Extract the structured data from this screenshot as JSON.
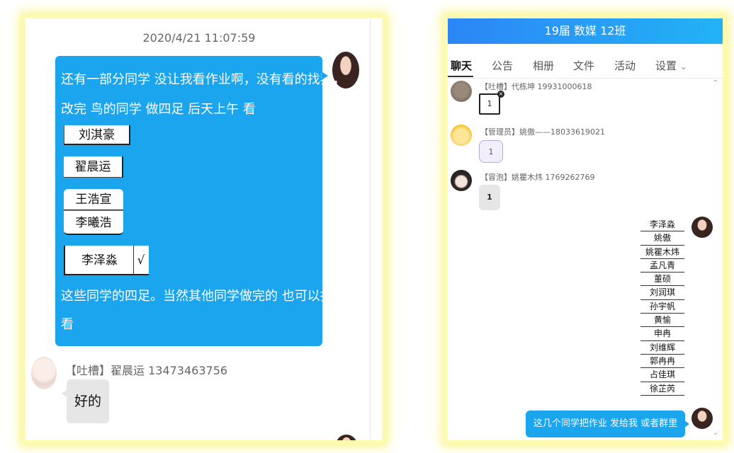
{
  "left": {
    "timestamp": "2020/4/21 11:07:59",
    "message_line1": "还有一部分同学 没让我看作业啊，没有看的找我，",
    "message_line2": "改完 鸟的同学 做四足 后天上午 看",
    "names": [
      "刘淇豪",
      "翟晨运",
      "王浩宣",
      "李曦浩",
      "李泽淼"
    ],
    "check_mark": "√",
    "message_line3": "这些同学的四足。当然其他同学做完的 也可以找我",
    "message_line4": "看",
    "reply_sender": "【吐槽】翟晨运 13473463756",
    "reply_text": "好的"
  },
  "right": {
    "header_title": "19届 数媒 12班",
    "tabs": [
      "聊天",
      "公告",
      "相册",
      "文件",
      "活动",
      "设置"
    ],
    "settings_caret": "⌄",
    "messages": [
      {
        "sender": "【吐槽】代栋坤  19931000618",
        "text": "1"
      },
      {
        "sender": "【管理员】姚傲——18033619021",
        "text": "1"
      },
      {
        "sender": "【冒泡】姚瞿木炜 1769262769",
        "text": "1"
      }
    ],
    "name_list": [
      "李泽淼",
      "姚傲",
      "姚瞿木炜",
      "孟凡青",
      "董硕",
      "刘润琪",
      "孙宇帆",
      "黄愉",
      "申冉",
      "刘维辉",
      "郭冉冉",
      "占佳琪",
      "徐芷芮"
    ],
    "final_message": "这几个同学把作业 发给我 或者群里",
    "scroll_up": "⌃",
    "scroll_down": "⌄"
  }
}
